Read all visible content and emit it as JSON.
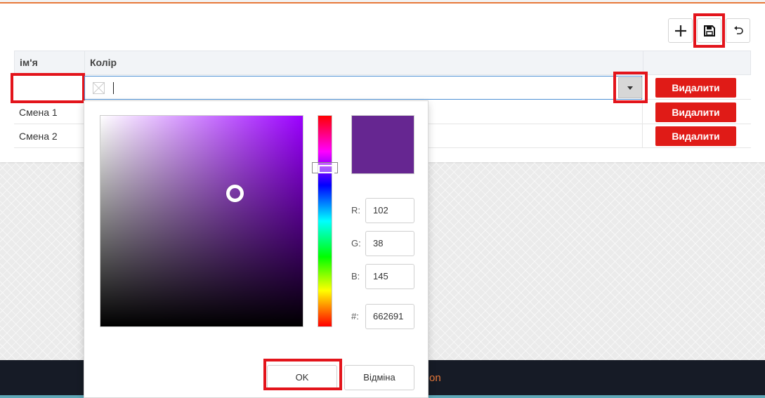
{
  "toolbar": {
    "add_icon": "plus-icon",
    "save_icon": "floppy-disk-icon",
    "undo_icon": "undo-icon"
  },
  "grid": {
    "columns": [
      "ім'я",
      "Колір",
      ""
    ],
    "edit_row": {
      "name_value": "",
      "color_value": ""
    },
    "rows": [
      {
        "name": "Смена 1",
        "delete_label": "Видалити"
      },
      {
        "name": "Смена 2",
        "delete_label": "Видалити"
      }
    ],
    "edit_delete_label": "Видалити"
  },
  "color_picker": {
    "r_label": "R:",
    "r_value": "102",
    "g_label": "G:",
    "g_value": "38",
    "b_label": "B:",
    "b_value": "145",
    "hex_label": "#:",
    "hex_value": "662691",
    "ok_label": "OK",
    "cancel_label": "Відміна",
    "selected_color": "#662691",
    "hue_color": "#9b00ff"
  },
  "footer": {
    "visible_text": "on"
  },
  "colors": {
    "accent_orange": "#e8793a",
    "delete_red": "#e01b17",
    "highlight_red": "#e3141b",
    "footer_bg": "#161b26"
  }
}
